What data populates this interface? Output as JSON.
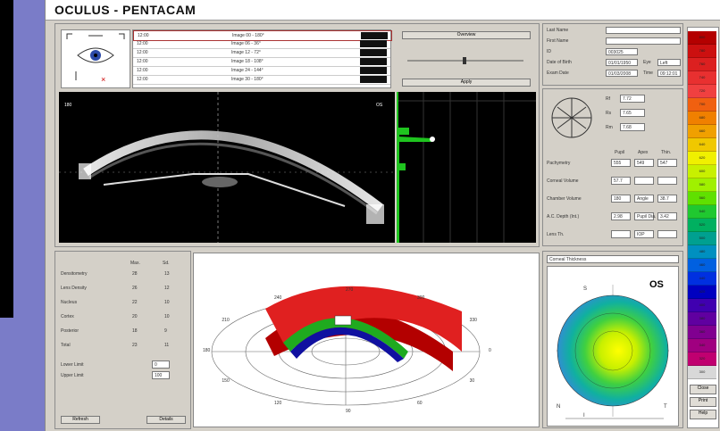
{
  "app": {
    "title": "OCULUS  -  PENTACAM"
  },
  "camera_table": {
    "rows": [
      {
        "c1": "12:00",
        "c2": "Image 00 - 180°"
      },
      {
        "c1": "12:00",
        "c2": "Image 06 - 36°"
      },
      {
        "c1": "12:00",
        "c2": "Image 12 - 72°"
      },
      {
        "c1": "12:00",
        "c2": "Image 18 - 108°"
      },
      {
        "c1": "12:00",
        "c2": "Image 24 - 144°"
      },
      {
        "c1": "12:00",
        "c2": "Image 30 - 180°"
      }
    ],
    "top_button": "Overview",
    "bottom_button": "Apply"
  },
  "scheimpflug": {
    "left_label": "180",
    "right_label": "OS"
  },
  "patient": {
    "fields": [
      {
        "label": "Last Name",
        "value": ""
      },
      {
        "label": "First Name",
        "value": ""
      },
      {
        "label": "ID",
        "value": "003025"
      },
      {
        "label": "Date of Birth",
        "value": "01/01/1950"
      },
      {
        "label": "Exam Date",
        "value": "01/03/2008"
      }
    ],
    "side_fields": [
      {
        "label": "Eye",
        "value": "Left"
      },
      {
        "label": "Time",
        "value": "09:12:01"
      }
    ]
  },
  "measurements": {
    "top": [
      {
        "label": "Rf",
        "value": "7.72"
      },
      {
        "label": "Rs",
        "value": "7.65"
      },
      {
        "label": "Rm",
        "value": "7.68"
      }
    ],
    "header": [
      "Pupil",
      "Apex",
      "Thin."
    ],
    "rows": [
      {
        "label": "Pachymetry",
        "v1": "555",
        "v2": "549",
        "v3": "547"
      },
      {
        "label": "Corneal Volume",
        "v1": "57.7",
        "v2": "",
        "v3": ""
      },
      {
        "label": "Chamber Volume",
        "v1": "180",
        "v2": "Angle",
        "v3": "38.7"
      },
      {
        "label": "A.C. Depth (Int.)",
        "v1": "2.98",
        "v2": "Pupil Dia.",
        "v3": "3.42"
      },
      {
        "label": "Lens Th.",
        "v1": "",
        "v2": "IOP",
        "v3": ""
      }
    ]
  },
  "lens_panel": {
    "header": [
      "Max.",
      "Sd."
    ],
    "rows": [
      {
        "label": "Densitometry",
        "v1": "28",
        "v2": "13"
      },
      {
        "label": "Lens Density",
        "v1": "26",
        "v2": "12"
      },
      {
        "label": "Nucleus",
        "v1": "22",
        "v2": "10"
      },
      {
        "label": "Cortex",
        "v1": "20",
        "v2": "10"
      },
      {
        "label": "Posterior",
        "v1": "18",
        "v2": "9"
      },
      {
        "label": "Total",
        "v1": "23",
        "v2": "11"
      }
    ],
    "spinners": [
      {
        "label": "Lower Limit",
        "value": "0"
      },
      {
        "label": "Upper Limit",
        "value": "100"
      }
    ],
    "buttons": [
      "Refresh",
      "Details"
    ]
  },
  "view3d": {
    "tick_labels": [
      "0",
      "30",
      "60",
      "90",
      "120",
      "150",
      "180",
      "210",
      "240",
      "270",
      "300",
      "330"
    ]
  },
  "map": {
    "dropdown": "Corneal Thickness",
    "eye": "OS",
    "n_label": "N",
    "t_label": "T",
    "s_label": "S",
    "i_label": "I"
  },
  "palette": {
    "colors": [
      "#b40000",
      "#cc1010",
      "#dc2020",
      "#e83030",
      "#f04040",
      "#f06010",
      "#f08000",
      "#f0a000",
      "#f0c800",
      "#f0f000",
      "#c8f000",
      "#a0f000",
      "#60e000",
      "#20c830",
      "#00b060",
      "#00a090",
      "#0090c0",
      "#0060e0",
      "#0030e0",
      "#0000c0",
      "#4000b0",
      "#6000a0",
      "#800090",
      "#a00080",
      "#c00070",
      "#d8d8d8"
    ],
    "labels": [
      "800",
      "780",
      "760",
      "740",
      "720",
      "700",
      "680",
      "660",
      "640",
      "620",
      "600",
      "580",
      "560",
      "540",
      "520",
      "500",
      "480",
      "460",
      "440",
      "420",
      "400",
      "380",
      "360",
      "340",
      "320",
      "300"
    ],
    "buttons": [
      "Close",
      "Print",
      "Help"
    ]
  }
}
